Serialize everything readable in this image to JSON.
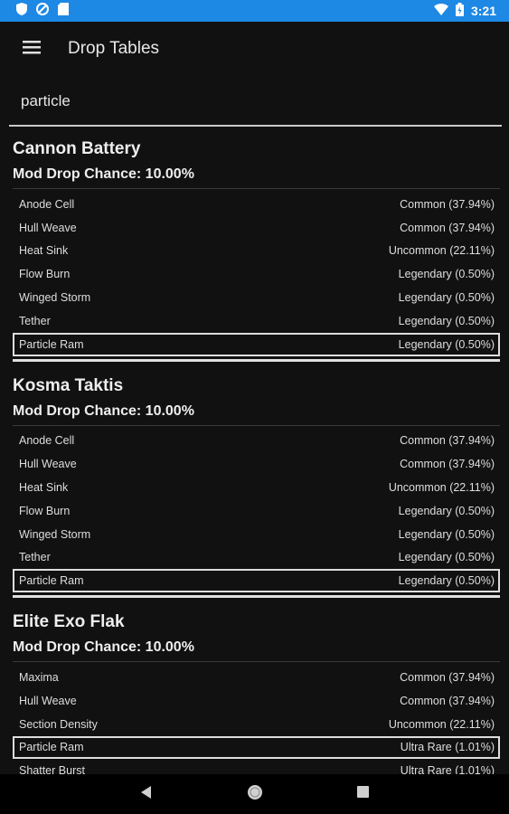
{
  "status_bar": {
    "time": "3:21",
    "icons": [
      "shield-icon",
      "circle-slash-icon",
      "sd-card-icon",
      "wifi-icon",
      "battery-icon"
    ],
    "color": "#1e88e5"
  },
  "app_bar": {
    "title": "Drop Tables",
    "menu_icon": "menu-icon"
  },
  "search": {
    "value": "particle",
    "placeholder": ""
  },
  "sections": [
    {
      "title": "Cannon Battery",
      "mod_chance": "Mod Drop Chance: 10.00%",
      "rows": [
        {
          "name": "Anode Cell",
          "rarity": "Common (37.94%)",
          "highlight": false
        },
        {
          "name": "Hull Weave",
          "rarity": "Common (37.94%)",
          "highlight": false
        },
        {
          "name": "Heat Sink",
          "rarity": "Uncommon (22.11%)",
          "highlight": false
        },
        {
          "name": "Flow Burn",
          "rarity": "Legendary (0.50%)",
          "highlight": false
        },
        {
          "name": "Winged Storm",
          "rarity": "Legendary (0.50%)",
          "highlight": false
        },
        {
          "name": "Tether",
          "rarity": "Legendary (0.50%)",
          "highlight": false
        },
        {
          "name": "Particle Ram",
          "rarity": "Legendary (0.50%)",
          "highlight": true
        }
      ]
    },
    {
      "title": "Kosma Taktis",
      "mod_chance": "Mod Drop Chance: 10.00%",
      "rows": [
        {
          "name": "Anode Cell",
          "rarity": "Common (37.94%)",
          "highlight": false
        },
        {
          "name": "Hull Weave",
          "rarity": "Common (37.94%)",
          "highlight": false
        },
        {
          "name": "Heat Sink",
          "rarity": "Uncommon (22.11%)",
          "highlight": false
        },
        {
          "name": "Flow Burn",
          "rarity": "Legendary (0.50%)",
          "highlight": false
        },
        {
          "name": "Winged Storm",
          "rarity": "Legendary (0.50%)",
          "highlight": false
        },
        {
          "name": "Tether",
          "rarity": "Legendary (0.50%)",
          "highlight": false
        },
        {
          "name": "Particle Ram",
          "rarity": "Legendary (0.50%)",
          "highlight": true
        }
      ]
    },
    {
      "title": "Elite Exo Flak",
      "mod_chance": "Mod Drop Chance: 10.00%",
      "rows": [
        {
          "name": "Maxima",
          "rarity": "Common (37.94%)",
          "highlight": false
        },
        {
          "name": "Hull Weave",
          "rarity": "Common (37.94%)",
          "highlight": false
        },
        {
          "name": "Section Density",
          "rarity": "Uncommon (22.11%)",
          "highlight": false
        },
        {
          "name": "Particle Ram",
          "rarity": "Ultra Rare (1.01%)",
          "highlight": true
        },
        {
          "name": "Shatter Burst",
          "rarity": "Ultra Rare (1.01%)",
          "highlight": false
        }
      ]
    }
  ],
  "nav_bar": {
    "buttons": [
      "back-icon",
      "home-icon",
      "recents-icon"
    ]
  }
}
